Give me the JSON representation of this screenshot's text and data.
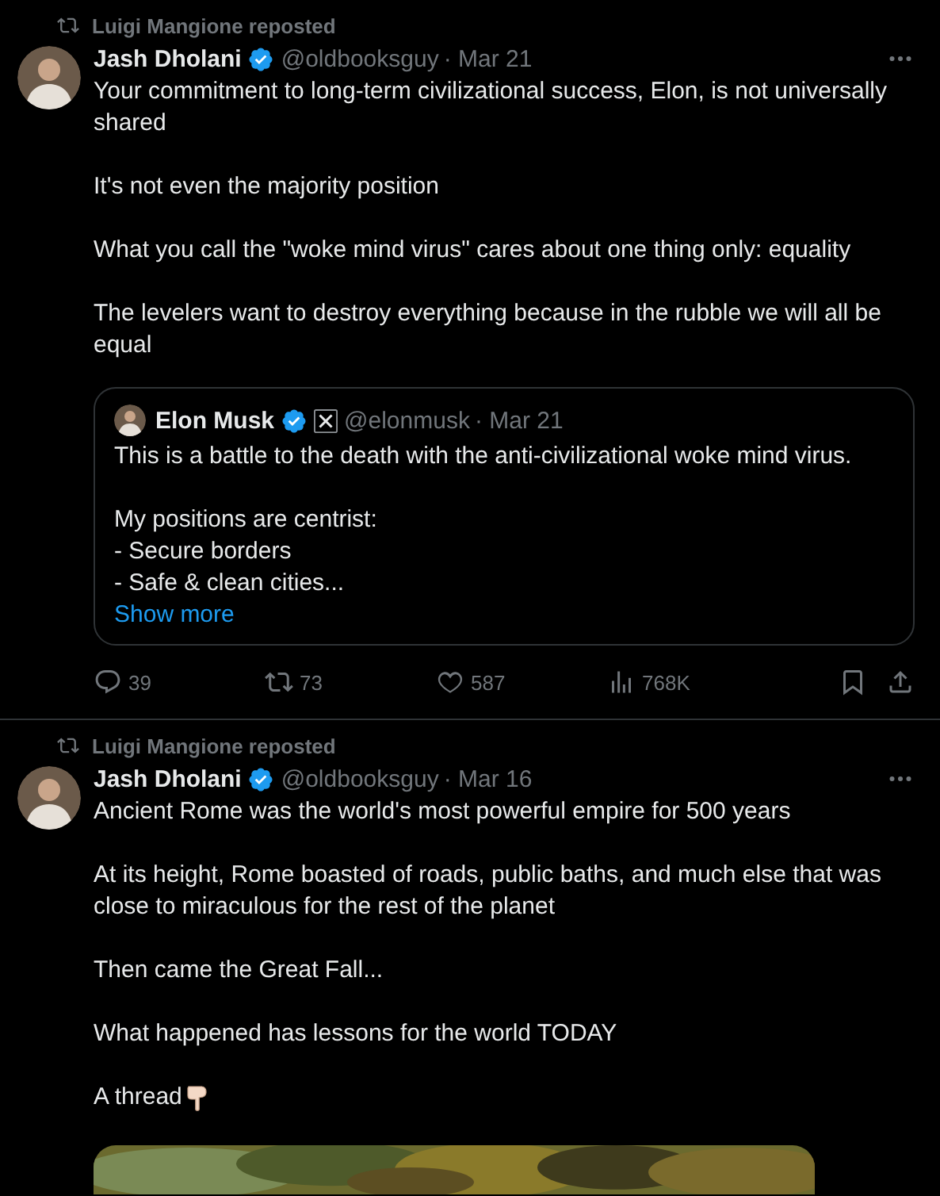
{
  "posts": [
    {
      "repost_by": "Luigi Mangione reposted",
      "author": {
        "name": "Jash Dholani",
        "verified": true,
        "handle": "@oldbooksguy",
        "date": "· Mar 21"
      },
      "paragraphs": [
        {
          "text": "Your commitment to long-term civilizational success, Elon, is not universally shared"
        },
        {
          "text": "It's not even the majority position"
        },
        {
          "text": "What you call the \"woke mind virus\" cares about one thing only: equality"
        },
        {
          "text": "The levelers want to destroy everything because in the rubble we will all be equal"
        }
      ],
      "quote": {
        "author": {
          "name": "Elon Musk",
          "verified": true,
          "affiliated": true,
          "handle": "@elonmusk",
          "date": "· Mar 21"
        },
        "paragraphs": [
          {
            "text": "This is a battle to the death with the anti-civilizational woke mind virus."
          },
          {
            "text": "My positions are centrist:\n- Secure borders\n- Safe & clean cities..."
          }
        ],
        "show_more": "Show more"
      },
      "actions": {
        "replies": "39",
        "reposts": "73",
        "likes": "587",
        "views": "768K"
      }
    },
    {
      "repost_by": "Luigi Mangione reposted",
      "author": {
        "name": "Jash Dholani",
        "verified": true,
        "handle": "@oldbooksguy",
        "date": "· Mar 16"
      },
      "paragraphs": [
        {
          "text": "Ancient Rome was the world's most powerful empire for 500 years"
        },
        {
          "text": "At its height, Rome boasted of roads, public baths, and much else that was close to miraculous for the rest of the planet"
        },
        {
          "text": "Then came the Great Fall..."
        },
        {
          "text": "What happened has lessons for the world TODAY"
        },
        {
          "text": "A thread",
          "pointing_hand": true
        }
      ]
    }
  ]
}
